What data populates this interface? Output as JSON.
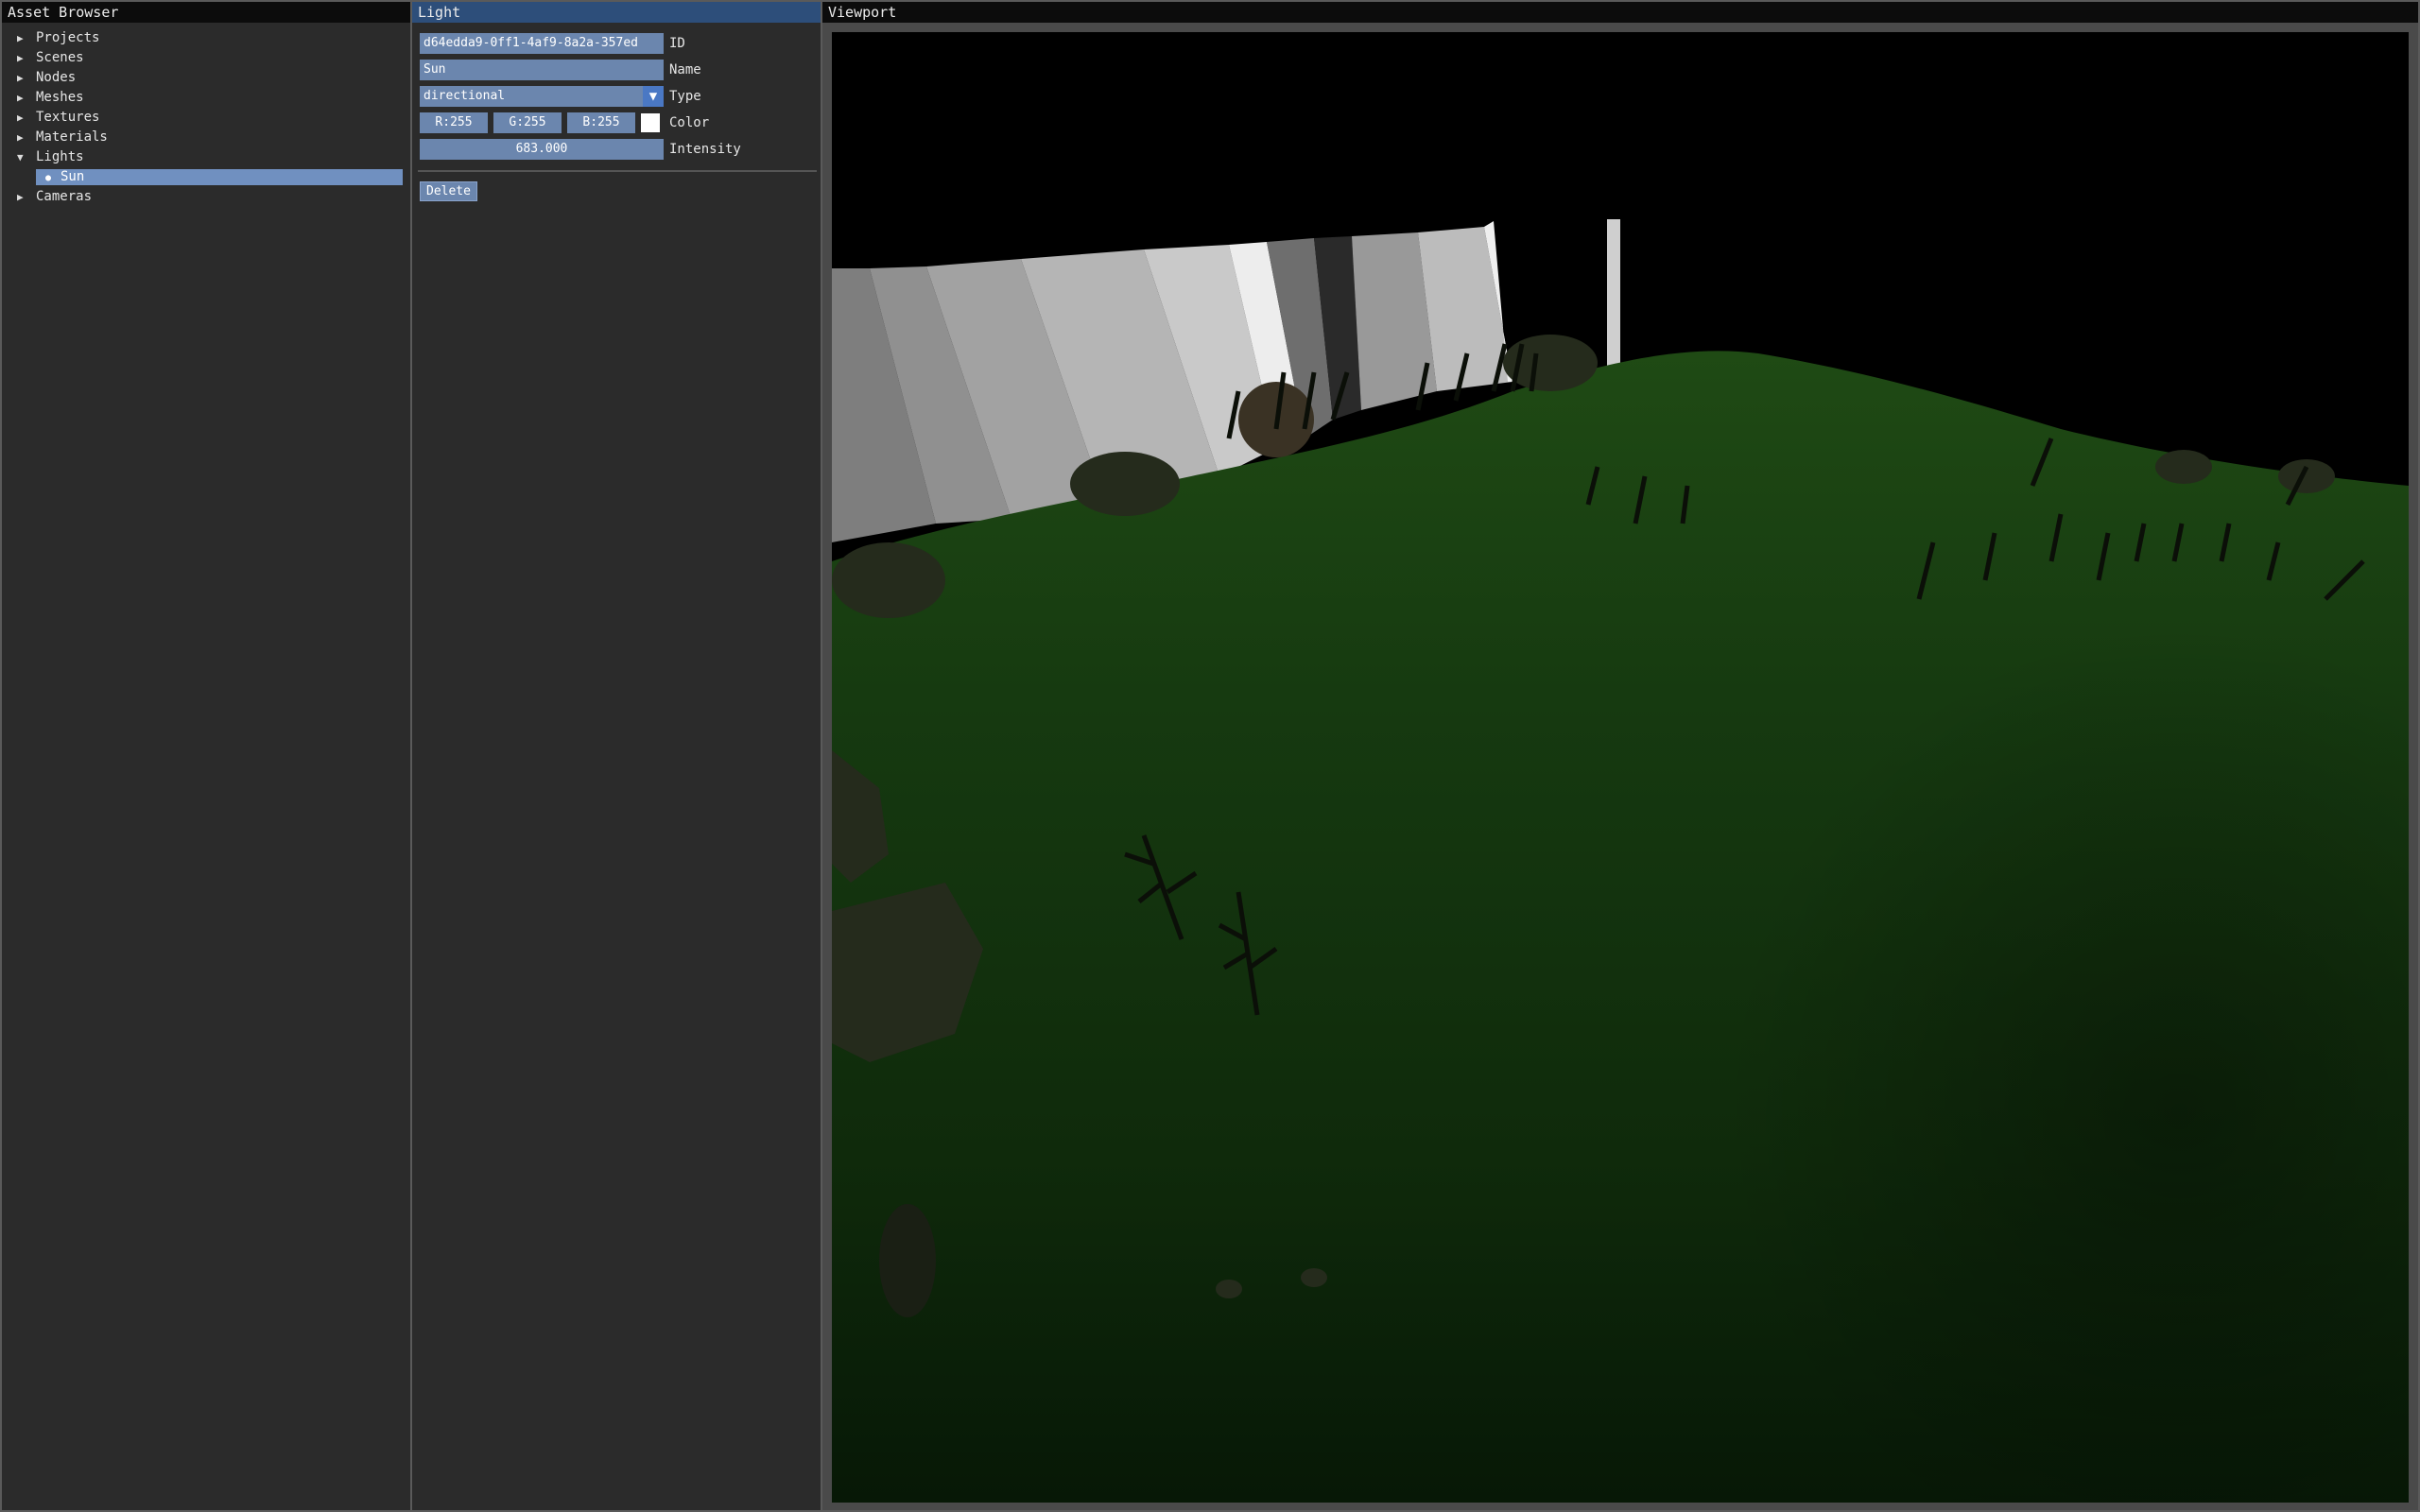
{
  "asset_browser": {
    "title": "Asset Browser",
    "items": [
      {
        "label": "Projects",
        "expanded": false
      },
      {
        "label": "Scenes",
        "expanded": false
      },
      {
        "label": "Nodes",
        "expanded": false
      },
      {
        "label": "Meshes",
        "expanded": false
      },
      {
        "label": "Textures",
        "expanded": false
      },
      {
        "label": "Materials",
        "expanded": false
      },
      {
        "label": "Lights",
        "expanded": true,
        "children": [
          {
            "label": "Sun",
            "selected": true
          }
        ]
      },
      {
        "label": "Cameras",
        "expanded": false
      }
    ]
  },
  "light_panel": {
    "title": "Light",
    "id_value": "d64edda9-0ff1-4af9-8a2a-357ed",
    "id_label": "ID",
    "name_value": "Sun",
    "name_label": "Name",
    "type_value": "directional",
    "type_label": "Type",
    "color": {
      "r": "R:255",
      "g": "G:255",
      "b": "B:255",
      "swatch": "#ffffff"
    },
    "color_label": "Color",
    "intensity_value": "683.000",
    "intensity_label": "Intensity",
    "delete_label": "Delete"
  },
  "viewport": {
    "title": "Viewport"
  },
  "colors": {
    "title_active": "#2d4e7a",
    "field": "#6b86ae",
    "selection": "#7090c0",
    "panel": "#2b2b2b"
  },
  "icons": {
    "collapsed": "triangle-right-icon",
    "expanded": "triangle-down-icon",
    "dropdown": "triangle-down-icon"
  }
}
